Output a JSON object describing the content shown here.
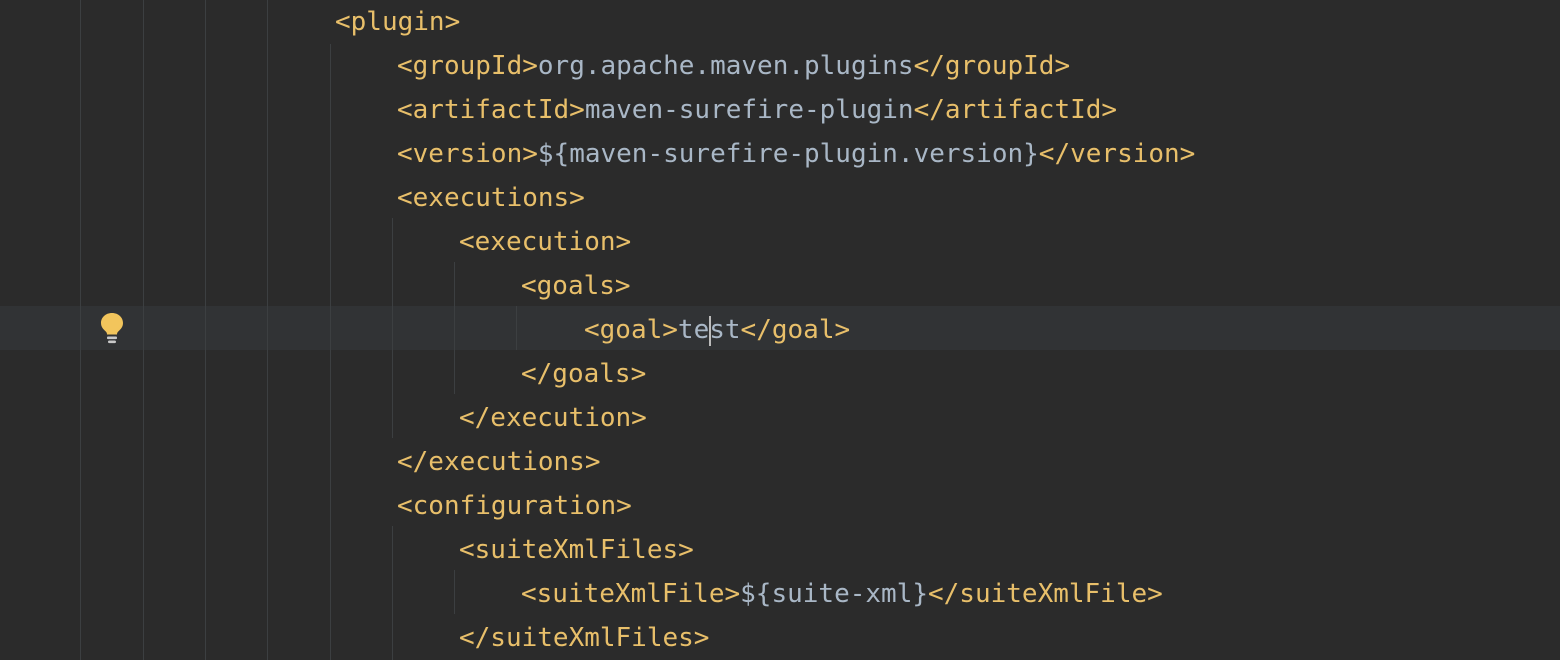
{
  "editor": {
    "lines": [
      {
        "open": "<plugin>",
        "text": "",
        "close": ""
      },
      {
        "open": "<groupId>",
        "text": "org.apache.maven.plugins",
        "close": "</groupId>"
      },
      {
        "open": "<artifactId>",
        "text": "maven-surefire-plugin",
        "close": "</artifactId>"
      },
      {
        "open": "<version>",
        "text": "${maven-surefire-plugin.version}",
        "close": "</version>"
      },
      {
        "open": "<executions>",
        "text": "",
        "close": ""
      },
      {
        "open": "<execution>",
        "text": "",
        "close": ""
      },
      {
        "open": "<goals>",
        "text": "",
        "close": ""
      },
      {
        "open": "<goal>",
        "text_before_caret": "te",
        "text_after_caret": "st",
        "close": "</goal>"
      },
      {
        "open": "</goals>",
        "text": "",
        "close": ""
      },
      {
        "open": "</execution>",
        "text": "",
        "close": ""
      },
      {
        "open": "</executions>",
        "text": "",
        "close": ""
      },
      {
        "open": "<configuration>",
        "text": "",
        "close": ""
      },
      {
        "open": "<suiteXmlFiles>",
        "text": "",
        "close": ""
      },
      {
        "open": "<suiteXmlFile>",
        "text": "${suite-xml}",
        "close": "</suiteXmlFile>"
      },
      {
        "open": "</suiteXmlFiles>",
        "text": "",
        "close": ""
      }
    ]
  },
  "gutter": {
    "intention_icon": "lightbulb-icon",
    "intention_color": "#f2c55c"
  },
  "colors": {
    "background": "#2b2b2b",
    "current_line": "#313335",
    "tag": "#e8bf6a",
    "text": "#a9b7c6"
  }
}
